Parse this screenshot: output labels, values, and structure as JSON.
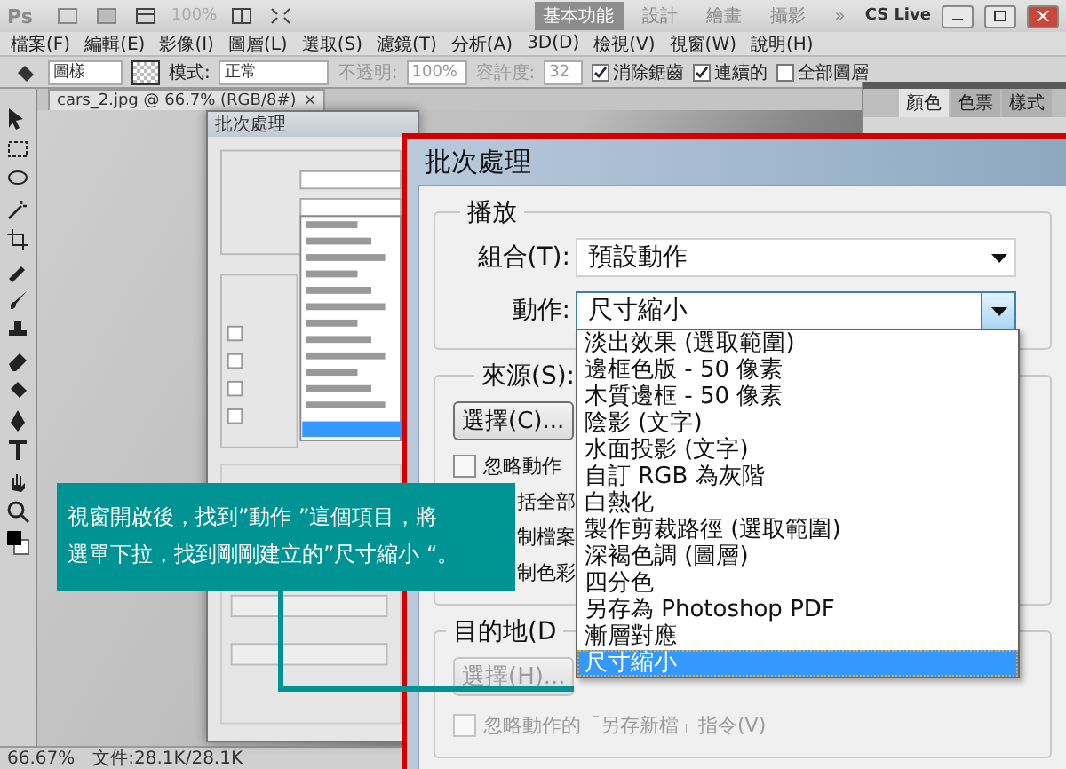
{
  "app": {
    "logo": "Ps",
    "zoom": "100%"
  },
  "workspaces": [
    {
      "label": "基本功能",
      "selected": true
    },
    {
      "label": "設計",
      "selected": false
    },
    {
      "label": "繪畫",
      "selected": false
    },
    {
      "label": "攝影",
      "selected": false
    }
  ],
  "more": "»",
  "cs_live": "CS Live",
  "menu": [
    "檔案(F)",
    "編輯(E)",
    "影像(I)",
    "圖層(L)",
    "選取(S)",
    "濾鏡(T)",
    "分析(A)",
    "3D(D)",
    "檢視(V)",
    "視窗(W)",
    "說明(H)"
  ],
  "options": {
    "tool_preset": "圖樣",
    "mode_label": "模式:",
    "mode": "正常",
    "opacity_label": "不透明:",
    "opacity": "100%",
    "tolerance_label": "容許度:",
    "tolerance": "32",
    "checkboxes": [
      {
        "label": "消除鋸齒",
        "checked": true
      },
      {
        "label": "連續的",
        "checked": true
      },
      {
        "label": "全部圖層",
        "checked": false
      }
    ]
  },
  "document_tab": {
    "title": "cars_2.jpg @ 66.7% (RGB/8#)",
    "close": "×"
  },
  "panel_tabs": [
    {
      "label": "顏色",
      "selected": true
    },
    {
      "label": "色票",
      "selected": false
    },
    {
      "label": "樣式",
      "selected": false
    }
  ],
  "background_dialog": {
    "title": "批次處理"
  },
  "dialog": {
    "title": "批次處理",
    "play": {
      "legend": "播放",
      "set_label": "組合(T):",
      "set_value": "預設動作",
      "action_label": "動作:",
      "action_value": "尺寸縮小",
      "action_options": [
        {
          "label": "淡出效果 (選取範圍)",
          "selected": false
        },
        {
          "label": "邊框色版 - 50 像素",
          "selected": false
        },
        {
          "label": "木質邊框 - 50 像素",
          "selected": false
        },
        {
          "label": "陰影 (文字)",
          "selected": false
        },
        {
          "label": "水面投影 (文字)",
          "selected": false
        },
        {
          "label": "自訂 RGB 為灰階",
          "selected": false
        },
        {
          "label": "白熱化",
          "selected": false
        },
        {
          "label": "製作剪裁路徑 (選取範圍)",
          "selected": false
        },
        {
          "label": "深褐色調 (圖層)",
          "selected": false
        },
        {
          "label": "四分色",
          "selected": false
        },
        {
          "label": "另存為 Photoshop PDF",
          "selected": false
        },
        {
          "label": "漸層對應",
          "selected": false
        },
        {
          "label": "尺寸縮小",
          "selected": true
        }
      ]
    },
    "source": {
      "legend": "來源(S):",
      "button": "選擇(C)...",
      "options": [
        {
          "label": "忽略動作",
          "checked": false
        },
        {
          "label": "括全部"
        },
        {
          "label": "制檔案"
        },
        {
          "label": "制色彩"
        }
      ]
    },
    "destination": {
      "legend": "目的地(D",
      "button": "選擇(H)...",
      "disabled": true,
      "override": {
        "label": "忽略動作的「另存新檔」指令(V)",
        "checked": false,
        "disabled": true
      }
    }
  },
  "callout": {
    "lines": [
      "視窗開啟後，找到”動作 ”這個項目，將",
      "選單下拉，找到剛剛建立的”尺寸縮小 “。"
    ]
  },
  "status_bar": {
    "zoom": "66.67%",
    "doc_size": "文件:28.1K/28.1K"
  }
}
